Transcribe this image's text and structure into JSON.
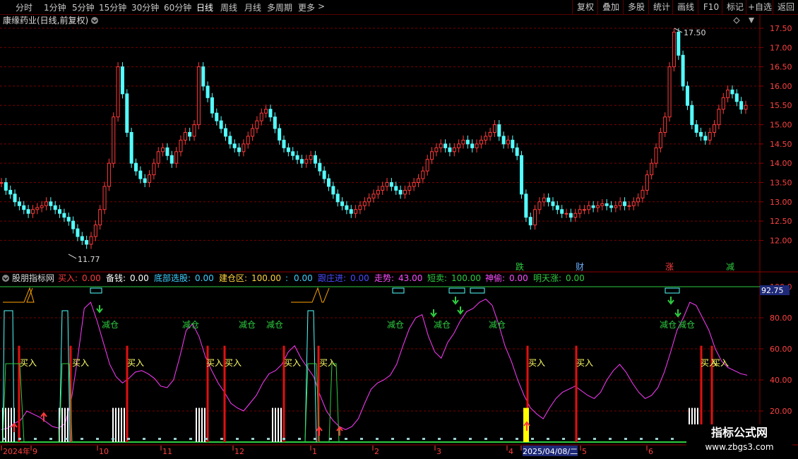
{
  "toolbar": {
    "timeframes": [
      {
        "label": "分时"
      },
      {
        "label": "1分钟"
      },
      {
        "label": "5分钟"
      },
      {
        "label": "15分钟"
      },
      {
        "label": "30分钟"
      },
      {
        "label": "60分钟"
      },
      {
        "label": "日线",
        "active": true
      },
      {
        "label": "周线"
      },
      {
        "label": "月线"
      },
      {
        "label": "多周期"
      },
      {
        "label": "更多"
      }
    ],
    "more_arrow": ">",
    "buttons": [
      {
        "label": "复权"
      },
      {
        "label": "叠加"
      },
      {
        "label": "多股"
      },
      {
        "label": "统计"
      },
      {
        "label": "画线"
      },
      {
        "label": "F10"
      },
      {
        "label": "标记"
      },
      {
        "label": "+自选"
      },
      {
        "label": "返回"
      }
    ]
  },
  "main": {
    "title": "康缘药业(日线,前复权)",
    "y_ticks": [
      "17.50",
      "17.00",
      "16.50",
      "16.00",
      "15.50",
      "15.00",
      "14.50",
      "14.00",
      "13.50",
      "13.00",
      "12.50",
      "12.00"
    ],
    "high_label": "17.50",
    "low_label": "11.77",
    "event_markers": [
      {
        "text": "跌",
        "color": "#2ecc40"
      },
      {
        "text": "财",
        "color": "#6ab0ff"
      },
      {
        "text": "涨",
        "color": "#ff4040"
      },
      {
        "text": "减",
        "color": "#2ecc40"
      }
    ]
  },
  "indicator": {
    "name": "股朋指标网",
    "params": [
      {
        "label": "买入:",
        "value": "0.00",
        "color": "#ff3b3b"
      },
      {
        "label": "备钱:",
        "value": "0.00",
        "color": "#ffffff"
      },
      {
        "label": "底部选股:",
        "value": "0.00",
        "color": "#3fd0ff"
      },
      {
        "label": "建仓区:",
        "value": "100.00",
        "color": "#ffd23f"
      },
      {
        "label": ":",
        "value": "0.00",
        "color": "#3fd0ff"
      },
      {
        "label": "跟庄进:",
        "value": "0.00",
        "color": "#4a4aff"
      },
      {
        "label": "走势:",
        "value": "43.00",
        "color": "#ff4cff"
      },
      {
        "label": "短卖:",
        "value": "100.00",
        "color": "#2ecc40"
      },
      {
        "label": "神偷:",
        "value": "0.00",
        "color": "#ff4cff"
      },
      {
        "label": "明天涨:",
        "value": "0.00",
        "color": "#2ecc40"
      }
    ],
    "y_ticks": [
      "100.0",
      "80.00",
      "60.00",
      "40.00",
      "20.00"
    ],
    "current_value": "92.75",
    "buy_label": "买入",
    "reduce_label": "减仓"
  },
  "x_axis": {
    "labels": [
      "2024年",
      "9",
      "10",
      "11",
      "12",
      "1",
      "2",
      "3",
      "4",
      "2025/04/08/二",
      "5",
      "6"
    ]
  },
  "watermark": {
    "line1": "指标公式网",
    "line2": "www.zbgs3.com"
  },
  "colors": {
    "up": "#ff3b3b",
    "down": "#54ffff",
    "grid": "#8b0000",
    "trend": "#ff3bff",
    "bg": "#000000"
  },
  "chart_data": {
    "type": "candlestick",
    "y_range": [
      11.77,
      17.5
    ],
    "closes": [
      13.5,
      13.3,
      13.2,
      13.0,
      12.9,
      12.8,
      12.7,
      12.8,
      12.85,
      12.9,
      13.0,
      12.9,
      12.8,
      12.7,
      12.6,
      12.5,
      12.3,
      12.1,
      12.0,
      11.9,
      12.1,
      12.4,
      12.8,
      13.4,
      14.0,
      15.2,
      16.5,
      15.8,
      14.8,
      14.0,
      13.8,
      13.6,
      13.5,
      13.7,
      14.0,
      14.3,
      14.4,
      14.2,
      14.0,
      14.3,
      14.6,
      14.8,
      14.7,
      15.0,
      16.5,
      16.0,
      15.7,
      15.3,
      15.1,
      14.9,
      14.7,
      14.5,
      14.4,
      14.3,
      14.5,
      14.7,
      14.9,
      15.1,
      15.3,
      15.4,
      15.2,
      14.9,
      14.6,
      14.4,
      14.3,
      14.2,
      14.1,
      14.0,
      14.1,
      14.2,
      14.0,
      13.8,
      13.6,
      13.4,
      13.2,
      13.0,
      12.9,
      12.8,
      12.7,
      12.8,
      12.9,
      13.0,
      13.1,
      13.2,
      13.3,
      13.4,
      13.5,
      13.4,
      13.3,
      13.2,
      13.3,
      13.4,
      13.5,
      13.6,
      13.8,
      14.1,
      14.3,
      14.4,
      14.5,
      14.4,
      14.3,
      14.4,
      14.5,
      14.6,
      14.5,
      14.4,
      14.5,
      14.6,
      14.7,
      14.8,
      15.0,
      14.7,
      14.5,
      14.6,
      14.4,
      14.2,
      13.2,
      12.6,
      12.4,
      12.8,
      13.0,
      13.1,
      13.0,
      12.9,
      12.8,
      12.7,
      12.7,
      12.6,
      12.7,
      12.8,
      12.8,
      12.9,
      12.85,
      12.9,
      12.95,
      12.9,
      12.85,
      12.9,
      13.0,
      12.9,
      12.9,
      13.0,
      13.1,
      13.3,
      13.7,
      14.0,
      14.4,
      14.8,
      15.2,
      16.5,
      17.4,
      16.8,
      16.0,
      15.5,
      15.0,
      14.8,
      14.7,
      14.6,
      14.8,
      15.0,
      15.4,
      15.7,
      15.9,
      15.8,
      15.6,
      15.4,
      15.5
    ]
  }
}
